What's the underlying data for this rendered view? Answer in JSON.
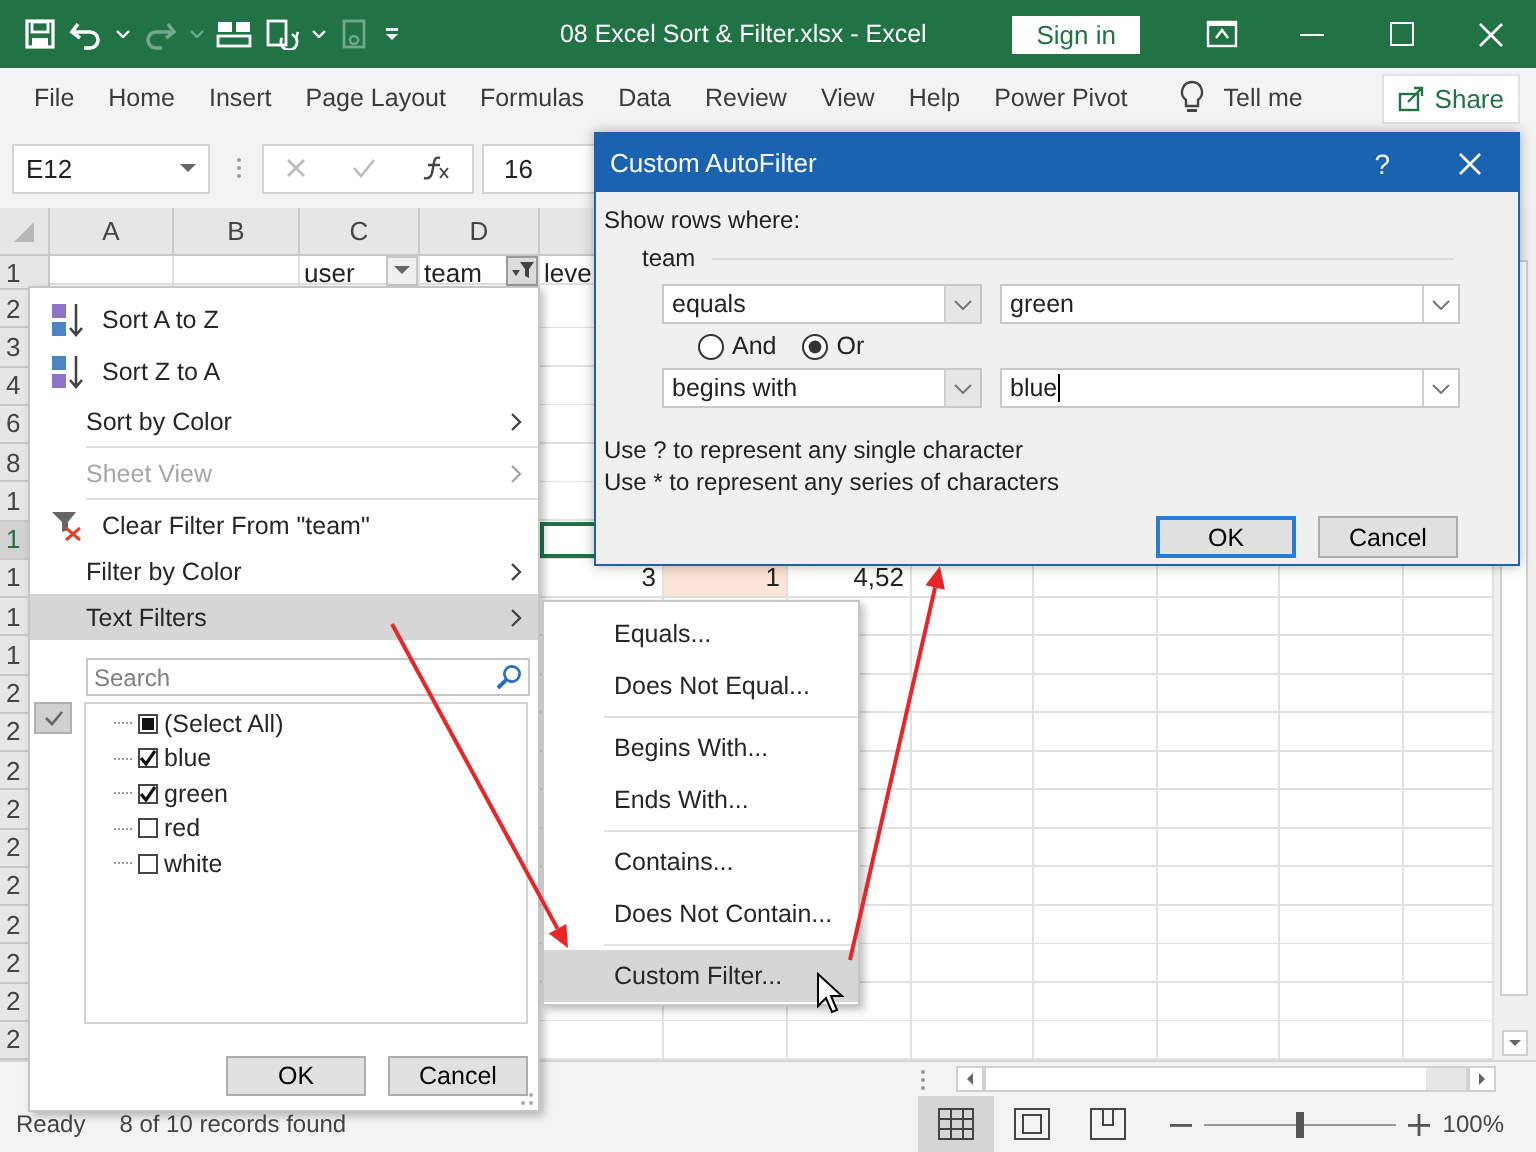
{
  "title_bar": {
    "title": "08 Excel Sort & Filter.xlsx  -  Excel",
    "sign_in": "Sign in"
  },
  "ribbon_tabs": [
    "File",
    "Home",
    "Insert",
    "Page Layout",
    "Formulas",
    "Data",
    "Review",
    "View",
    "Help",
    "Power Pivot"
  ],
  "tell_me": "Tell me",
  "share": "Share",
  "formula_bar": {
    "name_box": "E12",
    "formula": "16"
  },
  "sheet": {
    "columns": [
      "A",
      "B",
      "C",
      "D"
    ],
    "header_row": {
      "label": "1",
      "cells": [
        {
          "kind": "blank"
        },
        {
          "kind": "blank"
        },
        {
          "kind": "header",
          "text": "user",
          "filter_active": false
        },
        {
          "kind": "header",
          "text": "team",
          "filter_active": true
        },
        {
          "kind": "text",
          "text": "leve"
        }
      ]
    },
    "rows": [
      {
        "label": "2",
        "selected": false
      },
      {
        "label": "3",
        "selected": false
      },
      {
        "label": "4",
        "selected": false
      },
      {
        "label": "6",
        "selected": false
      },
      {
        "label": "8",
        "selected": false
      },
      {
        "label": "1",
        "selected": false
      },
      {
        "label": "1",
        "selected": true
      },
      {
        "label": "1",
        "selected": false,
        "cells": [
          {
            "text": "3",
            "highlight": false
          },
          {
            "text": "1",
            "highlight": true
          },
          {
            "text": "4,52",
            "highlight": false
          }
        ]
      },
      {
        "label": "1",
        "selected": false
      },
      {
        "label": "1",
        "selected": false
      },
      {
        "label": "2",
        "selected": false
      },
      {
        "label": "2",
        "selected": false
      },
      {
        "label": "2",
        "selected": false
      },
      {
        "label": "2",
        "selected": false
      },
      {
        "label": "2",
        "selected": false
      },
      {
        "label": "2",
        "selected": false
      },
      {
        "label": "2",
        "selected": false
      },
      {
        "label": "2",
        "selected": false
      },
      {
        "label": "2",
        "selected": false
      },
      {
        "label": "2",
        "selected": false
      }
    ]
  },
  "filter_menu": {
    "items": [
      {
        "kind": "sort_asc",
        "label": "Sort A to Z",
        "submenu": false,
        "disabled": false,
        "highlighted": false
      },
      {
        "kind": "sort_desc",
        "label": "Sort Z to A",
        "submenu": false,
        "disabled": false,
        "highlighted": false
      },
      {
        "kind": "plain",
        "label": "Sort by Color",
        "submenu": true,
        "disabled": false,
        "highlighted": false
      },
      {
        "kind": "separator"
      },
      {
        "kind": "plain",
        "label": "Sheet View",
        "submenu": true,
        "disabled": true,
        "highlighted": false
      },
      {
        "kind": "separator"
      },
      {
        "kind": "clear_filter",
        "label": "Clear Filter From \"team\"",
        "submenu": false,
        "disabled": false,
        "highlighted": false
      },
      {
        "kind": "plain",
        "label": "Filter by Color",
        "submenu": true,
        "disabled": false,
        "highlighted": false
      },
      {
        "kind": "plain",
        "label": "Text Filters",
        "submenu": true,
        "disabled": false,
        "highlighted": true
      }
    ],
    "search": {
      "placeholder": "Search"
    },
    "values": [
      {
        "label": "(Select All)",
        "checked": false,
        "mixed": true
      },
      {
        "label": "blue",
        "checked": true,
        "mixed": false
      },
      {
        "label": "green",
        "checked": true,
        "mixed": false
      },
      {
        "label": "red",
        "checked": false,
        "mixed": false
      },
      {
        "label": "white",
        "checked": false,
        "mixed": false
      }
    ],
    "buttons": [
      "OK",
      "Cancel"
    ]
  },
  "text_filters_menu": [
    {
      "kind": "item",
      "label": "Equals...",
      "highlighted": false
    },
    {
      "kind": "item",
      "label": "Does Not Equal...",
      "highlighted": false
    },
    {
      "kind": "separator"
    },
    {
      "kind": "item",
      "label": "Begins With...",
      "highlighted": false
    },
    {
      "kind": "item",
      "label": "Ends With...",
      "highlighted": false
    },
    {
      "kind": "separator"
    },
    {
      "kind": "item",
      "label": "Contains...",
      "highlighted": false
    },
    {
      "kind": "item",
      "label": "Does Not Contain...",
      "highlighted": false
    },
    {
      "kind": "separator"
    },
    {
      "kind": "item",
      "label": "Custom Filter...",
      "highlighted": true
    }
  ],
  "dialog": {
    "title": "Custom AutoFilter",
    "help": "?",
    "prompt": "Show rows where:",
    "field": "team",
    "conditions": [
      {
        "operator": "equals",
        "value": "green"
      },
      {
        "operator": "begins with",
        "value": "blue"
      }
    ],
    "join": [
      {
        "label": "And",
        "selected": false
      },
      {
        "label": "Or",
        "selected": true
      }
    ],
    "hints": [
      "Use ? to represent any single character",
      "Use * to represent any series of characters"
    ],
    "buttons": [
      {
        "label": "OK",
        "default": true
      },
      {
        "label": "Cancel",
        "default": false
      }
    ]
  },
  "status_bar": {
    "ready": "Ready",
    "records": "8 of 10 records found",
    "views": [
      {
        "kind": "normal",
        "selected": true
      },
      {
        "kind": "page_layout",
        "selected": false
      },
      {
        "kind": "page_break",
        "selected": false
      }
    ],
    "zoom": {
      "level": 0.5,
      "reading": "100%"
    }
  }
}
